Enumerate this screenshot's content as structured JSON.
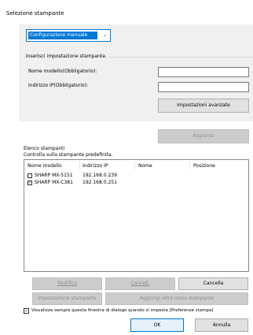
{
  "window": {
    "title": "Selezione stampante"
  },
  "mode_select": {
    "value": "Configurazione manuale"
  },
  "manual": {
    "group_label": "Inserisci impostazione stampante.",
    "model_label": "Nome modello(Obbligatorio):",
    "model_value": "",
    "ip_label": "Indirizzo IP(Obbligatorio):",
    "ip_value": "",
    "advanced_button": "Impostazioni avanzate",
    "add_button": "Aggiunta"
  },
  "printers": {
    "heading": "Elenco stampanti",
    "subheading": "Controlla sulla stampante predefinita.",
    "columns": [
      "Nome modello",
      "Indirizzo IP",
      "Nome",
      "Posizione"
    ],
    "rows": [
      {
        "checked": false,
        "model": "SHARP MX-5151",
        "ip": "192.168.0.239",
        "name": "",
        "location": ""
      },
      {
        "checked": true,
        "model": "SHARP MX-C381",
        "ip": "192.168.0.251",
        "name": "",
        "location": ""
      }
    ]
  },
  "actions": {
    "edit": "Modifica",
    "cancel_item": "Cancell.",
    "clear": "Cancella",
    "printer_settings": "Impostazione stampante",
    "add_icon": "Aggiungi altra icona stampante"
  },
  "footer": {
    "always_show_checked": true,
    "always_show_label": "Visualizza sempre questa finestra di dialogo quando si imposta [Preferenze stampa]",
    "ok": "OK",
    "cancel": "Annulla"
  },
  "colors": {
    "accent": "#0078d7",
    "panel": "#f0f0f0",
    "button": "#e1e1e1",
    "disabled": "#cccccc"
  }
}
